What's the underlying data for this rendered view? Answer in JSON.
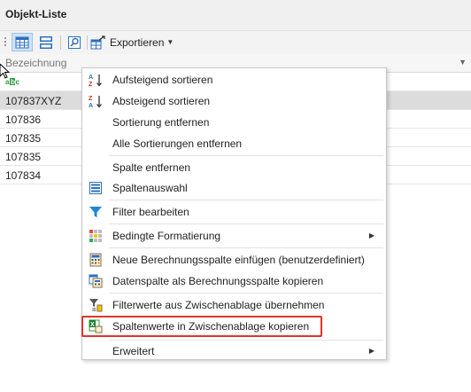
{
  "window": {
    "title": "Objekt-Liste"
  },
  "toolbar": {
    "export_label": "Exportieren"
  },
  "grid": {
    "column_header": "Bezeichnung",
    "filter_indicator": "ABC",
    "rows": [
      "107837XYZ",
      "107836",
      "107835",
      "107835",
      "107834"
    ],
    "selected_row_index": 0
  },
  "context_menu": {
    "items": [
      {
        "label": "Aufsteigend sortieren",
        "icon": "sort-ascending-icon"
      },
      {
        "label": "Absteigend sortieren",
        "icon": "sort-descending-icon"
      },
      {
        "label": "Sortierung entfernen",
        "icon": ""
      },
      {
        "label": "Alle Sortierungen entfernen",
        "icon": ""
      },
      {
        "label": "Spalte entfernen",
        "icon": ""
      },
      {
        "label": "Spaltenauswahl",
        "icon": "column-chooser-icon"
      },
      {
        "label": "Filter bearbeiten",
        "icon": "filter-icon"
      },
      {
        "label": "Bedingte Formatierung",
        "icon": "conditional-format-icon",
        "submenu": true
      },
      {
        "label": "Neue Berechnungsspalte einfügen (benutzerdefiniert)",
        "icon": "calculator-icon"
      },
      {
        "label": "Datenspalte als Berechnungsspalte kopieren",
        "icon": "copy-column-icon"
      },
      {
        "label": "Filterwerte aus Zwischenablage übernehmen",
        "icon": "paste-filter-icon"
      },
      {
        "label": "Spaltenwerte in Zwischenablage kopieren",
        "icon": "excel-copy-icon",
        "highlighted": true
      },
      {
        "label": "Erweitert",
        "icon": "",
        "submenu": true
      }
    ]
  },
  "colors": {
    "highlight_border": "#e0342c",
    "selected_row": "#dcdcdc",
    "filter_icon": "#1e88d6"
  }
}
